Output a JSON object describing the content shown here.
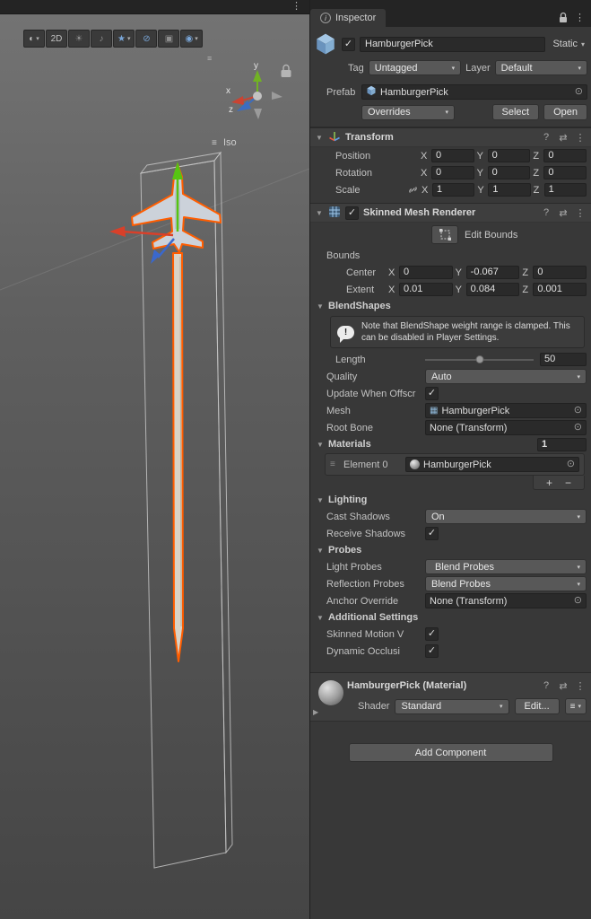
{
  "icons": {
    "kebab": "⋮",
    "dropdown": "▾",
    "foldout_open": "▼",
    "foldout_closed": "▶",
    "picker": "⊙",
    "check": "✓",
    "menu": "≡",
    "plus": "+",
    "minus": "−",
    "help": "?",
    "presets": "⇄",
    "warn": "!",
    "info": "i",
    "mesh": "▦"
  },
  "scene": {
    "topbar_menu": "⋮",
    "toolbar": {
      "shaded_icon": "◐",
      "mode_2d": "2D",
      "lighting_icon": "☀",
      "audio_icon": "♪",
      "effects_icon": "★",
      "visibility_icon": "⊘",
      "camera_icon": "▣",
      "gizmos_icon": "◉"
    },
    "orientation": {
      "x": "x",
      "y": "y",
      "z": "z",
      "mode": "Iso"
    }
  },
  "inspector": {
    "tab": "Inspector",
    "axis": {
      "x": "X",
      "y": "Y",
      "z": "Z"
    },
    "gameobject": {
      "name": "HamburgerPick",
      "static": "Static",
      "tag_label": "Tag",
      "tag": "Untagged",
      "layer_label": "Layer",
      "layer": "Default",
      "prefab_label": "Prefab",
      "prefab": "HamburgerPick",
      "overrides": "Overrides",
      "select": "Select",
      "open": "Open"
    },
    "transform": {
      "title": "Transform",
      "rows": [
        {
          "label": "Position",
          "x": "0",
          "y": "0",
          "z": "0"
        },
        {
          "label": "Rotation",
          "x": "0",
          "y": "0",
          "z": "0"
        },
        {
          "label": "Scale",
          "x": "1",
          "y": "1",
          "z": "1"
        }
      ]
    },
    "smr": {
      "title": "Skinned Mesh Renderer",
      "edit_bounds": "Edit Bounds",
      "bounds": "Bounds",
      "center": {
        "label": "Center",
        "x": "0",
        "y": "-0.067",
        "z": "0"
      },
      "extent": {
        "label": "Extent",
        "x": "0.01",
        "y": "0.084",
        "z": "0.001"
      },
      "blendshapes": "BlendShapes",
      "warning": "Note that BlendShape weight range is clamped. This can be disabled in Player Settings.",
      "length_label": "Length",
      "length_value": "50",
      "quality_label": "Quality",
      "quality": "Auto",
      "update_offscreen_label": "Update When Offscr",
      "mesh_label": "Mesh",
      "mesh": "HamburgerPick",
      "root_bone_label": "Root Bone",
      "root_bone": "None (Transform)",
      "materials_label": "Materials",
      "materials_size": "1",
      "element0_label": "Element 0",
      "element0": "HamburgerPick",
      "lighting": "Lighting",
      "cast_shadows_label": "Cast Shadows",
      "cast_shadows": "On",
      "receive_shadows_label": "Receive Shadows",
      "probes": "Probes",
      "light_probes_label": "Light Probes",
      "light_probes": "Blend Probes",
      "reflection_probes_label": "Reflection Probes",
      "reflection_probes": "Blend Probes",
      "anchor_label": "Anchor Override",
      "anchor": "None (Transform)",
      "additional": "Additional Settings",
      "skinned_motion_label": "Skinned Motion V",
      "dynamic_occlusion_label": "Dynamic Occlusi"
    },
    "material": {
      "title": "HamburgerPick (Material)",
      "shader_label": "Shader",
      "shader": "Standard",
      "edit": "Edit..."
    },
    "add_component": "Add Component"
  },
  "colors": {
    "selection_outline": "#ff5d00",
    "axis_x": "#d8402a",
    "axis_y": "#56c413",
    "axis_z": "#3a68cc",
    "panel_bg": "#383838",
    "field_bg": "#2a2a2a",
    "control_bg": "#585858"
  }
}
